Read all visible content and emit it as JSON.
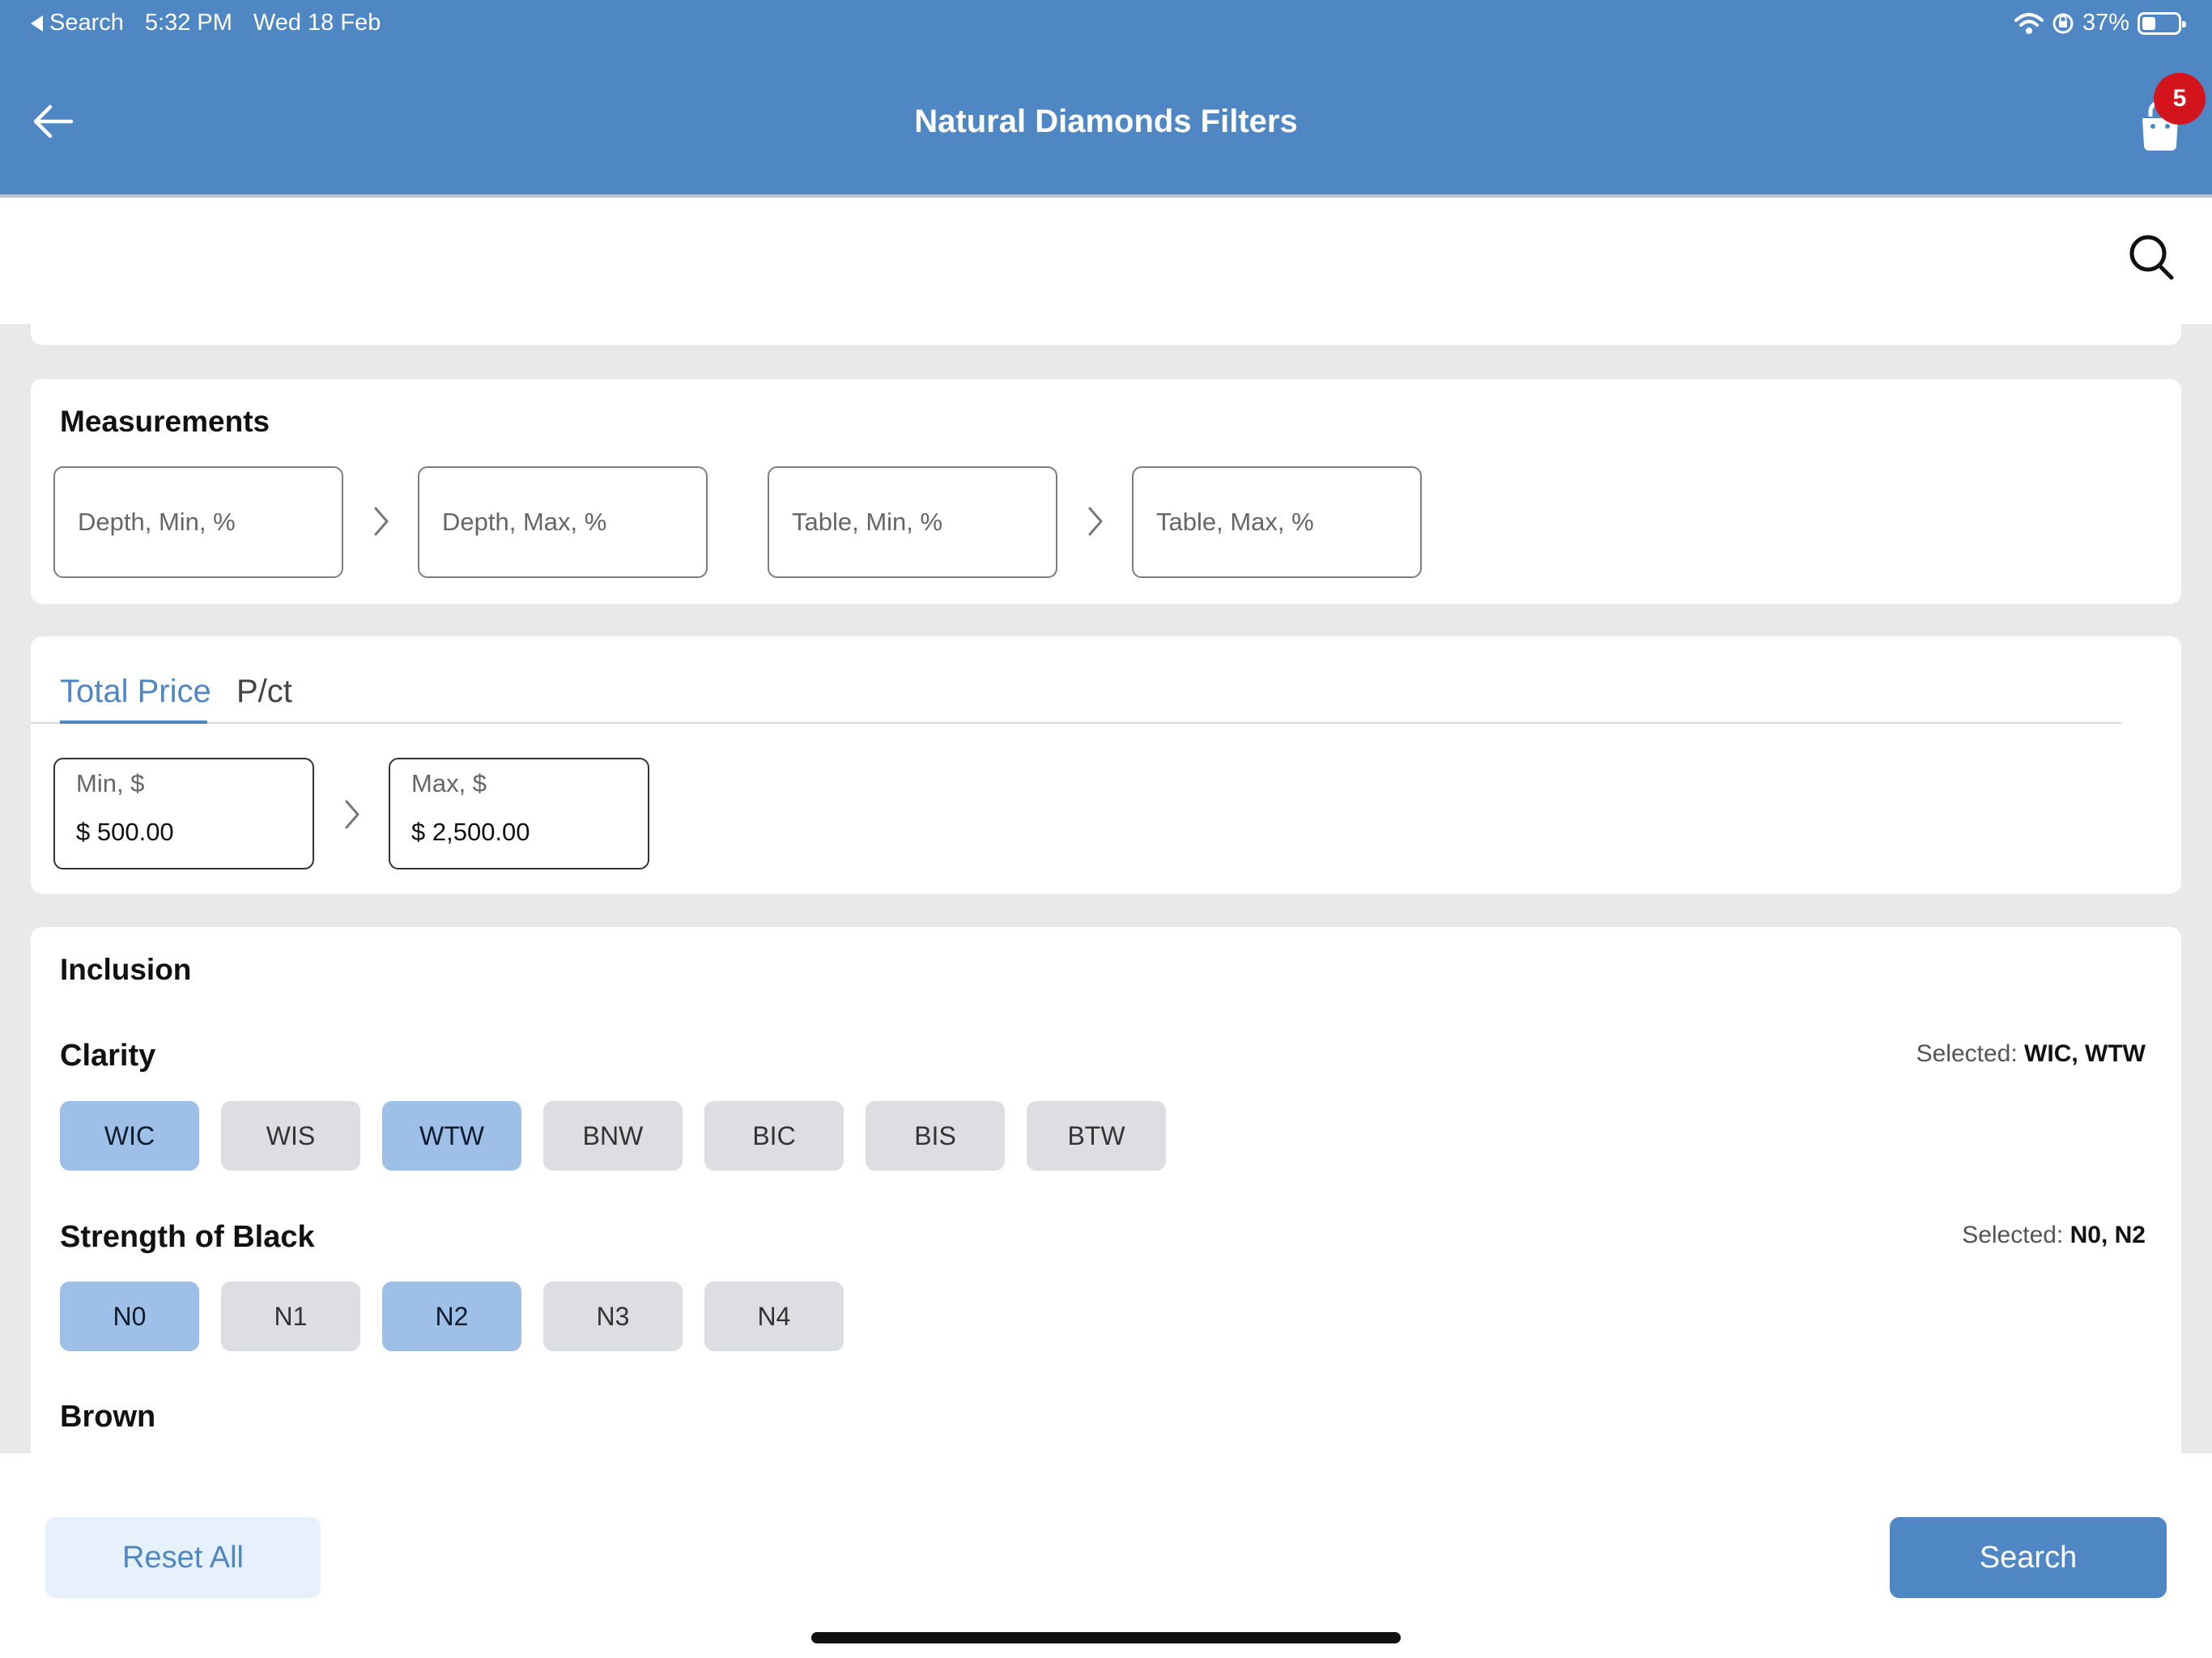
{
  "status_bar": {
    "back_label": "Search",
    "time": "5:32 PM",
    "date": "Wed 18 Feb",
    "battery_text": "37%",
    "battery_level": 0.37
  },
  "header": {
    "title": "Natural Diamonds Filters",
    "cart_count": "5",
    "color": "#4f87c4"
  },
  "measurements": {
    "title": "Measurements",
    "depth_min_placeholder": "Depth, Min, %",
    "depth_max_placeholder": "Depth, Max, %",
    "table_min_placeholder": "Table, Min, %",
    "table_max_placeholder": "Table, Max, %"
  },
  "price": {
    "tabs": [
      "Total Price",
      "P/ct"
    ],
    "active_tab": "Total Price",
    "min_label": "Min, $",
    "min_value": "$ 500.00",
    "max_label": "Max, $",
    "max_value": "$ 2,500.00"
  },
  "inclusion": {
    "title": "Inclusion",
    "clarity": {
      "title": "Clarity",
      "selected_label": "Selected:",
      "selected_values": "WIC, WTW",
      "options": [
        "WIC",
        "WIS",
        "WTW",
        "BNW",
        "BIC",
        "BIS",
        "BTW"
      ],
      "active": [
        "WIC",
        "WTW"
      ]
    },
    "strength": {
      "title": "Strength of Black",
      "selected_label": "Selected:",
      "selected_values": "N0, N2",
      "options": [
        "N0",
        "N1",
        "N2",
        "N3",
        "N4"
      ],
      "active": [
        "N0",
        "N2"
      ]
    },
    "brown_title": "Brown"
  },
  "footer": {
    "reset_label": "Reset All",
    "search_label": "Search"
  }
}
